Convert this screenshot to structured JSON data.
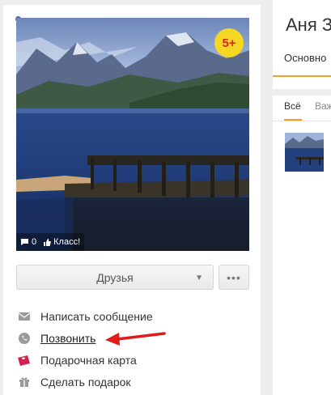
{
  "profile": {
    "name": "Аня З",
    "age_rating": "5+",
    "main_tab": "Основно"
  },
  "photo": {
    "comments_count": "0",
    "like_label": "Класс!"
  },
  "friends_button": {
    "label": "Друзья",
    "caret": "▼",
    "more": "•••"
  },
  "actions": [
    {
      "label": "Написать сообщение",
      "icon": "envelope-icon"
    },
    {
      "label": "Позвонить",
      "icon": "phone-icon"
    },
    {
      "label": "Подарочная карта",
      "icon": "gift-card-icon"
    },
    {
      "label": "Сделать подарок",
      "icon": "gift-icon"
    }
  ],
  "feed_tabs": {
    "all": "Всё",
    "important": "Важ"
  },
  "colors": {
    "accent": "#f59d2a",
    "badge_bg": "#f5d622",
    "badge_text": "#e02424",
    "arrow": "#e21a1a",
    "online": "#2f6ec6"
  }
}
